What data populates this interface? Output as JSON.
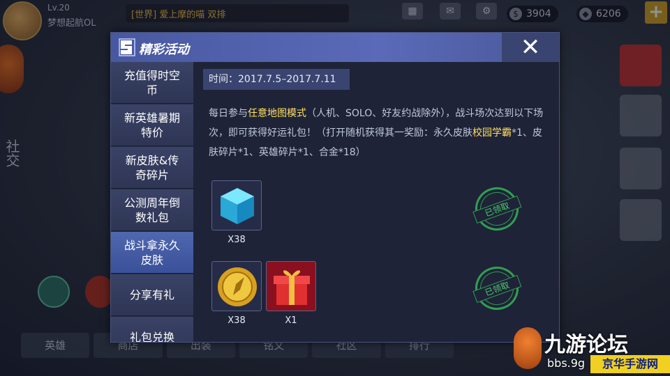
{
  "hud": {
    "level": "Lv.20",
    "player_name": "梦想起航OL",
    "chat_text": "[世界] 爱上摩的喵 双排",
    "coins": "3904",
    "diamonds": "6206",
    "social_label": "社交",
    "bottom_buttons": [
      "英雄",
      "商店",
      "出装",
      "铭文",
      "社区",
      "排行"
    ]
  },
  "dialog": {
    "title": "精彩活动",
    "close_label": "✕",
    "sidebar": [
      {
        "label": "充值得时空币",
        "active": false
      },
      {
        "label": "新英雄暑期特价",
        "active": false
      },
      {
        "label": "新皮肤&传奇碎片",
        "active": false
      },
      {
        "label": "公测周年倒数礼包",
        "active": false
      },
      {
        "label": "战斗拿永久皮肤",
        "active": true
      },
      {
        "label": "分享有礼",
        "active": false
      },
      {
        "label": "礼包兑换",
        "active": false
      }
    ],
    "time_label": "时间：2017.7.5–2017.7.11",
    "description": {
      "part1": "每日参与",
      "highlight1": "任意地图模式",
      "part2": "（人机、SOLO、好友约战除外），战斗场次达到以下场次，即可获得好运礼包！（打开随机获得其一奖励：永久皮肤",
      "highlight2": "校园学霸",
      "part3": "*1、皮肤碎片*1、英雄碎片*1、合金*18）"
    },
    "rewards": [
      {
        "items": [
          {
            "icon": "blue-cube-icon",
            "qty": "X38"
          }
        ],
        "status": "已领取"
      },
      {
        "items": [
          {
            "icon": "gold-coin-icon",
            "qty": "X38"
          },
          {
            "icon": "gift-box-icon",
            "qty": "X1"
          }
        ],
        "status": "已领取"
      }
    ]
  },
  "watermark": {
    "title": "九游论坛",
    "sub": "bbs.9g",
    "tag": "京华手游网"
  },
  "colors": {
    "dialog_bg": "#1e2338",
    "header": "#5a6ab8",
    "highlight_text": "#ffe060",
    "stamp_green": "#30a050"
  }
}
